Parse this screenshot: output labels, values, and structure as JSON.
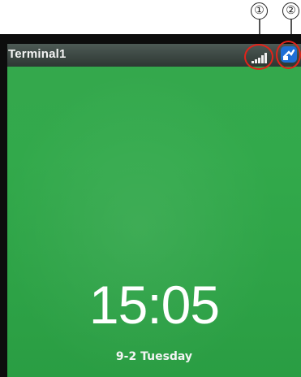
{
  "annotations": {
    "marker_1": "①",
    "marker_2": "②"
  },
  "status_bar": {
    "terminal_name": "Terminal1",
    "signal_icon": "signal-strength-icon",
    "network_icon": "network-connection-icon"
  },
  "home_screen": {
    "time": "15:05",
    "date": "9-2  Tuesday"
  },
  "colors": {
    "background_green": "#32a94b",
    "highlight_ring": "#e2231a",
    "network_icon_blue": "#1f6fd6"
  }
}
